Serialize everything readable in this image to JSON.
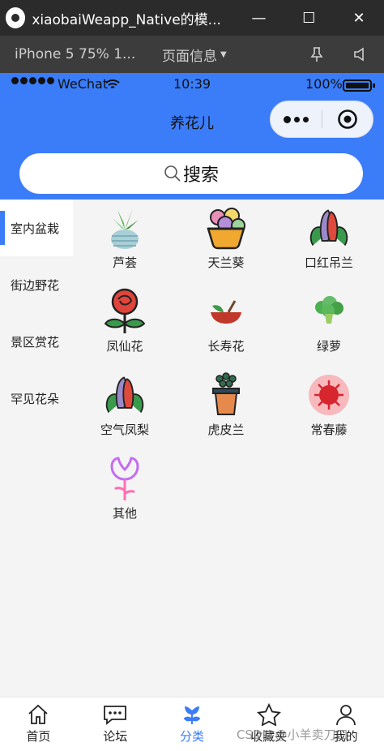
{
  "window": {
    "title": "xiaobaiWeapp_Native的模...",
    "minimize_label": "—",
    "maximize_label": "☐",
    "close_label": "✕"
  },
  "devtools": {
    "device_label": "iPhone 5 75% 1...",
    "page_info_label": "页面信息",
    "page_info_caret": "▼"
  },
  "statusbar": {
    "carrier": "WeChat",
    "time": "10:39",
    "battery_percent": "100%"
  },
  "navbar": {
    "title": "养花儿",
    "accent_color": "#3b7df8"
  },
  "search": {
    "label": "搜索"
  },
  "sidebar": {
    "items": [
      {
        "label": "室内盆栽",
        "active": true
      },
      {
        "label": "街边野花",
        "active": false
      },
      {
        "label": "景区赏花",
        "active": false
      },
      {
        "label": "罕见花朵",
        "active": false
      }
    ]
  },
  "grid": {
    "items": [
      {
        "label": "芦荟",
        "icon": "aloe-icon"
      },
      {
        "label": "天兰葵",
        "icon": "flower-basket-icon"
      },
      {
        "label": "口红吊兰",
        "icon": "lipstick-plant-icon"
      },
      {
        "label": "凤仙花",
        "icon": "rose-icon"
      },
      {
        "label": "长寿花",
        "icon": "bowl-plant-icon"
      },
      {
        "label": "绿萝",
        "icon": "broccoli-icon"
      },
      {
        "label": "空气凤梨",
        "icon": "air-plant-icon"
      },
      {
        "label": "虎皮兰",
        "icon": "snake-plant-icon"
      },
      {
        "label": "常春藤",
        "icon": "ivy-icon"
      },
      {
        "label": "其他",
        "icon": "tulip-outline-icon"
      }
    ]
  },
  "tabbar": {
    "items": [
      {
        "label": "首页",
        "icon": "home-icon",
        "active": false
      },
      {
        "label": "论坛",
        "icon": "chat-icon",
        "active": false
      },
      {
        "label": "分类",
        "icon": "category-flower-icon",
        "active": true
      },
      {
        "label": "收藏夹",
        "icon": "star-icon",
        "active": false
      },
      {
        "label": "我的",
        "icon": "user-icon",
        "active": false
      }
    ]
  },
  "watermark": "CSDN @小羊卖刀口"
}
